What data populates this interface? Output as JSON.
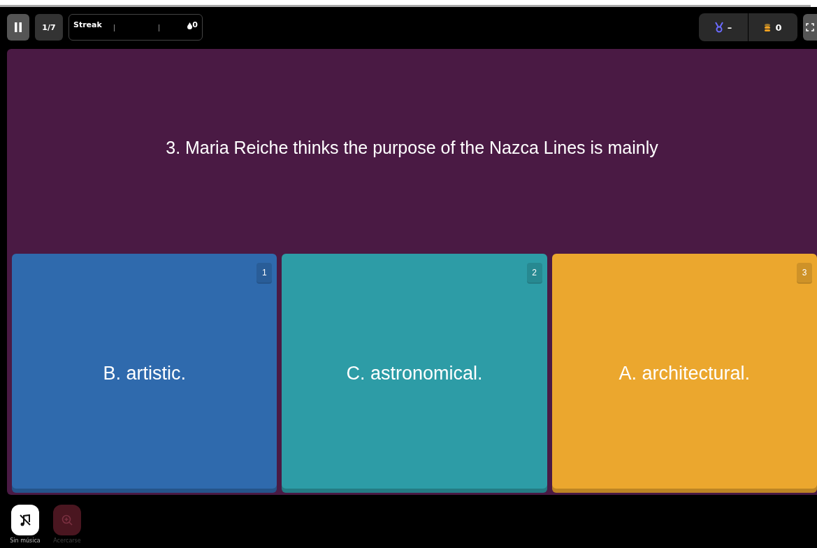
{
  "top_bar": {
    "counter": "1/7",
    "streak": {
      "label": "Streak",
      "count": "0"
    },
    "medal_value": "–",
    "coins": "0"
  },
  "question": {
    "text": "3. Maria Reiche thinks the purpose of the Nazca Lines is mainly"
  },
  "options": [
    {
      "key": "1",
      "text": "B. artistic.",
      "color": "#2f6aad"
    },
    {
      "key": "2",
      "text": "C. astronomical.",
      "color": "#2d9ca6"
    },
    {
      "key": "3",
      "text": "A. architectural.",
      "color": "#eba72e"
    }
  ],
  "bottom_tools": [
    {
      "kind": "music",
      "label": "Sin música",
      "disabled": false
    },
    {
      "kind": "zoom",
      "label": "Acercarse",
      "disabled": true
    }
  ]
}
